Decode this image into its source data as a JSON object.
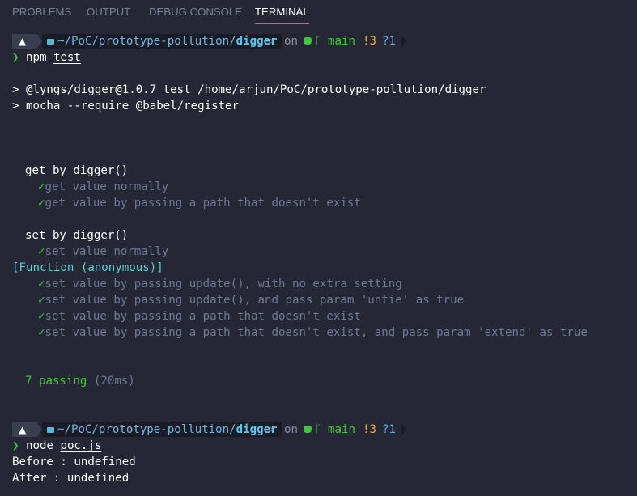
{
  "tabs": [
    {
      "label": "PROBLEMS",
      "active": false
    },
    {
      "label": "OUTPUT",
      "active": false
    },
    {
      "label": "DEBUG CONSOLE",
      "active": false
    },
    {
      "label": "TERMINAL",
      "active": true
    }
  ],
  "colors": {
    "background": "#252834",
    "pass_green": "#3ec93a",
    "path_blue": "#6fb6e8",
    "cyan": "#56d2d8",
    "dim": "#707898",
    "active_tab_underline": "#e84faa"
  },
  "prompt1": {
    "os_icon": "arch-linux-icon",
    "path_prefix": "~/PoC/prototype-pollution/",
    "path_current": "digger",
    "on": "on",
    "branch_icon": "git-branch-icon",
    "branch": "main",
    "modified": "!3",
    "untracked": "?1",
    "chevron": "❯",
    "command": "npm",
    "arg": "test"
  },
  "npm_header": {
    "line1": "> @lyngs/digger@1.0.7 test /home/arjun/PoC/prototype-pollution/digger",
    "line2": "> mocha --require @babel/register"
  },
  "suites": [
    {
      "title": "get by digger()",
      "tests": [
        {
          "check": "✓",
          "label": "get value normally"
        },
        {
          "check": "✓",
          "label": "get value by passing a path that doesn't exist"
        }
      ]
    },
    {
      "title": "set by digger()",
      "tests": [
        {
          "check": "✓",
          "label": "set value normally"
        }
      ],
      "log": "[Function (anonymous)]",
      "tests_after": [
        {
          "check": "✓",
          "label": "set value by passing update(), with no extra setting"
        },
        {
          "check": "✓",
          "label": "set value by passing update(), and pass param 'untie' as true"
        },
        {
          "check": "✓",
          "label": "set value by passing a path that doesn't exist"
        },
        {
          "check": "✓",
          "label": "set value by passing a path that doesn't exist, and pass param 'extend' as true"
        }
      ]
    }
  ],
  "summary": {
    "passing": "7 passing",
    "duration": "(20ms)"
  },
  "prompt2": {
    "os_icon": "arch-linux-icon",
    "path_prefix": "~/PoC/prototype-pollution/",
    "path_current": "digger",
    "on": "on",
    "branch_icon": "git-branch-icon",
    "branch": "main",
    "modified": "!3",
    "untracked": "?1",
    "chevron": "❯",
    "command": "node",
    "arg": "poc.js"
  },
  "output": {
    "before": "Before : undefined",
    "after": "After : undefined"
  }
}
